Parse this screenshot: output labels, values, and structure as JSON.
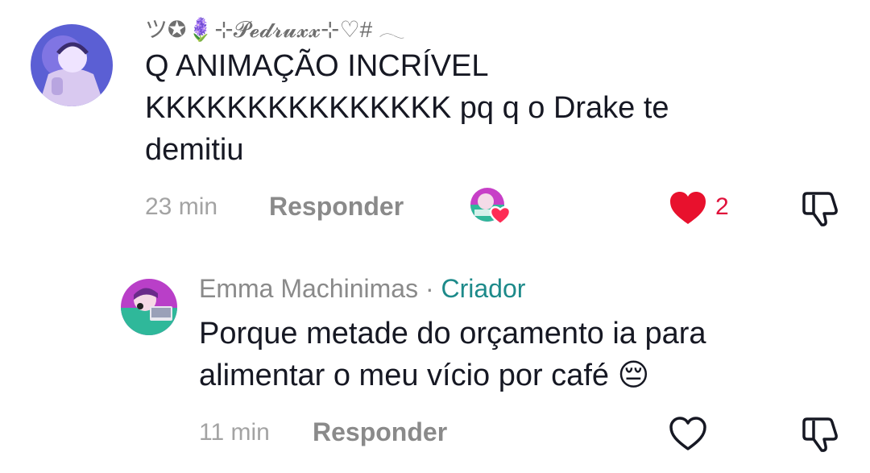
{
  "comments": [
    {
      "username": "ツ✪🪻⊹𝓟𝓮𝓭𝓻𝓾𝔁𝔁⊹♡# 𓂃",
      "text": "Q ANIMAÇÃO INCRÍVEL KKKKKKKKKKKKKKK pq q o Drake te demitiu",
      "time": "23 min",
      "reply_label": "Responder",
      "likes": "2",
      "liked": true,
      "creator_liked": true
    }
  ],
  "replies": [
    {
      "username": "Emma Machinimas",
      "separator": " · ",
      "creator_badge": "Criador",
      "text": "Porque metade do orçamento ia para alimentar o meu vício por café 😔",
      "time": "11 min",
      "reply_label": "Responder",
      "liked": false
    }
  ],
  "colors": {
    "like_red": "#e0103a",
    "creator_teal": "#1d8a8a",
    "muted_text": "#8a8a8a"
  },
  "icons": [
    "heart-icon",
    "dislike-icon",
    "creator-liked-avatar"
  ]
}
